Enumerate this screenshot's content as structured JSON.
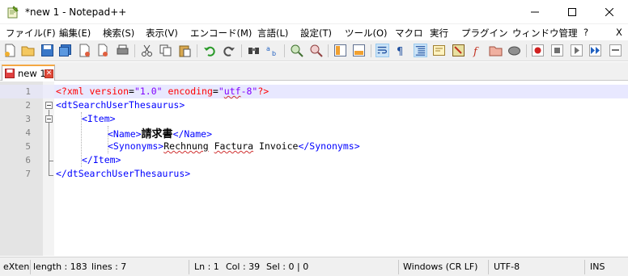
{
  "window": {
    "title": "*new 1 - Notepad++",
    "minimize_glyph": "—",
    "maximize_glyph": "☐",
    "close_glyph": "✕"
  },
  "menu": {
    "items": [
      "ファイル(F)",
      "編集(E)",
      "検索(S)",
      "表示(V)",
      "エンコード(M)",
      "言語(L)",
      "設定(T)",
      "ツール(O)",
      "マクロ",
      "実行",
      "プラグイン",
      "ウィンドウ管理",
      "?"
    ],
    "close_x": "X"
  },
  "toolbar": {
    "icons": [
      "new-file-icon",
      "open-file-icon",
      "save-icon",
      "save-all-icon",
      "close-icon",
      "close-all-icon",
      "print-icon",
      "cut-icon",
      "copy-icon",
      "paste-icon",
      "undo-icon",
      "redo-icon",
      "find-icon",
      "replace-icon",
      "zoom-in-icon",
      "zoom-out-icon",
      "sync-vertical-icon",
      "sync-horizontal-icon",
      "word-wrap-icon",
      "show-all-chars-icon",
      "indent-guide-icon",
      "udl-icon",
      "doc-map-icon",
      "function-list-icon",
      "folder-workspace-icon",
      "monitoring-icon",
      "record-macro-icon",
      "stop-macro-icon",
      "play-macro-icon",
      "run-macro-multiple-icon",
      "save-macro-icon"
    ]
  },
  "tab": {
    "label": "new 1",
    "close_glyph": "✕"
  },
  "editor": {
    "line_numbers": [
      "1",
      "2",
      "3",
      "4",
      "5",
      "6",
      "7"
    ],
    "lines": {
      "l1": {
        "pi_open": "<?xml ",
        "attr1": "version",
        "eq1": "=",
        "val1": "\"1.0\"",
        "sp": " ",
        "attr2": "encoding",
        "eq2": "=",
        "val2a": "\"",
        "val2b": "utf",
        "val2c": "-8\"",
        "pi_close": "?>"
      },
      "l2": {
        "tag": "<dtSearchUserThesaurus>"
      },
      "l3": {
        "tag": "<Item>"
      },
      "l4": {
        "open": "<Name>",
        "text": "請求書",
        "close": "</Name>"
      },
      "l5": {
        "open": "<Synonyms>",
        "w1": "Rechnung",
        "s1": " ",
        "w2": "Factura",
        "s2": " ",
        "w3": "Invoice",
        "close": "</Synonyms>"
      },
      "l6": {
        "tag": "</Item>"
      },
      "l7": {
        "tag": "</dtSearchUserThesaurus>"
      }
    }
  },
  "status": {
    "language": "eXten",
    "length": "length : 183",
    "lines": "lines : 7",
    "ln": "Ln : 1",
    "col": "Col : 39",
    "sel": "Sel : 0 | 0",
    "eol": "Windows (CR LF)",
    "encoding": "UTF-8",
    "mode": "INS"
  }
}
